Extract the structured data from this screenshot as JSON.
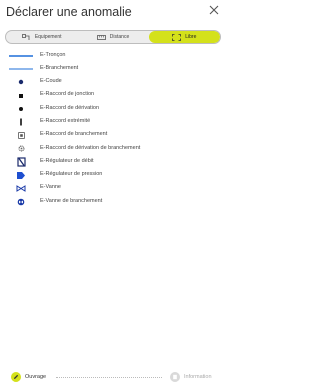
{
  "header": {
    "title": "Déclarer une anomalie"
  },
  "mode_tabs": [
    {
      "label": "Equipement",
      "icon": "equipment-icon",
      "active": false
    },
    {
      "label": "Distance",
      "icon": "ruler-icon",
      "active": false
    },
    {
      "label": "Libre",
      "icon": "frame-icon",
      "active": true
    }
  ],
  "anomaly_types": [
    {
      "label": "E-Tronçon",
      "symbol": "line"
    },
    {
      "label": "E-Branchement",
      "symbol": "line"
    },
    {
      "label": "E-Coude",
      "symbol": "dot"
    },
    {
      "label": "E-Raccord de jonction",
      "symbol": "square"
    },
    {
      "label": "E-Raccord de dérivation",
      "symbol": "dot"
    },
    {
      "label": "E-Raccord extrémité",
      "symbol": "bar"
    },
    {
      "label": "E-Raccord de branchement",
      "symbol": "boxed-square"
    },
    {
      "label": "E-Raccord de dérivation de branchement",
      "symbol": "gear"
    },
    {
      "label": "E-Régulateur de débit",
      "symbol": "flow-regulator"
    },
    {
      "label": "E-Régulateur de pression",
      "symbol": "pressure-regulator"
    },
    {
      "label": "E-Vanne",
      "symbol": "valve"
    },
    {
      "label": "E-Vanne de branchement",
      "symbol": "branch-valve"
    }
  ],
  "stepper": {
    "step1": {
      "label": "Ouvrage",
      "icon": "pencil-icon",
      "active": true
    },
    "step2": {
      "label": "Information",
      "icon": "document-icon",
      "active": false
    }
  },
  "colors": {
    "accent": "#d4e11b",
    "line_blue": "#1e6fd9",
    "symbol_dark": "#1a2a6c"
  }
}
